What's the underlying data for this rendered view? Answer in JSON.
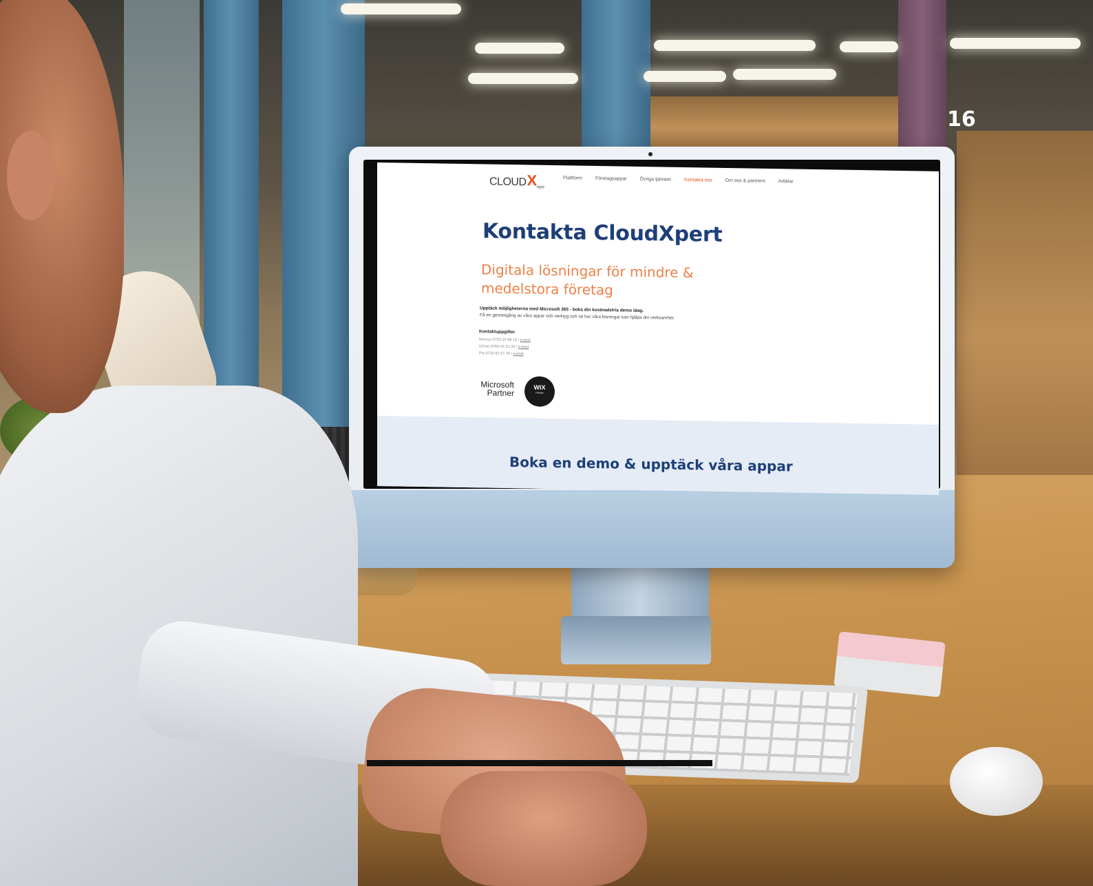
{
  "page_number": "16",
  "website": {
    "logo": {
      "main": "CLOUD",
      "x": "X",
      "suffix": "PERT"
    },
    "nav": [
      {
        "label": "Plattform",
        "active": false
      },
      {
        "label": "Företagsappar",
        "active": false
      },
      {
        "label": "Övriga tjänster",
        "active": false
      },
      {
        "label": "Kontakta oss",
        "active": true
      },
      {
        "label": "Om oss & partners",
        "active": false
      },
      {
        "label": "Artiklar",
        "active": false
      }
    ],
    "hero": {
      "title": "Kontakta CloudXpert",
      "subtitle_line1": "Digitala lösningar för mindre &",
      "subtitle_line2": "medelstora företag",
      "lead_bold": "Upptäck möjligheterna med Microsoft 365 - boka din kostnadsfria demo idag.",
      "lead_text": "Få en genomgång av våra appar och verktyg och se hur våra lösningar kan hjälpa din verksamhet."
    },
    "contact": {
      "heading": "Kontaktuppgifter",
      "entries": [
        {
          "text": "Marcus 0733-15 98 15 / ",
          "email_label": "e-post"
        },
        {
          "text": "Göran 0760-52 53 20 / ",
          "email_label": "e-post"
        },
        {
          "text": "Pia 0733-62 07 40 / ",
          "email_label": "e-post"
        }
      ]
    },
    "badges": {
      "microsoft_line1": "Microsoft",
      "microsoft_line2": "Partner",
      "wix_main": "WIX",
      "wix_sub": "Partner"
    },
    "band_title": "Boka en demo & upptäck våra appar"
  },
  "colors": {
    "brand_navy": "#1e3f78",
    "brand_orange": "#ee7f47",
    "nav_active": "#e8501e",
    "band_bg": "#e5ecf6"
  }
}
